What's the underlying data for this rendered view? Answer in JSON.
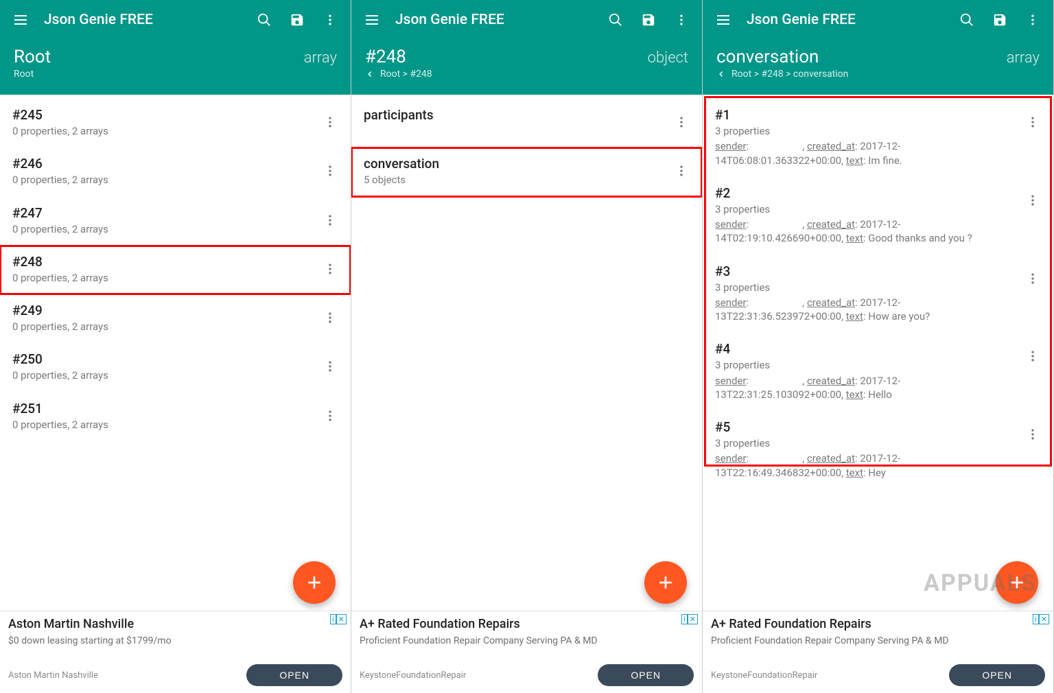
{
  "app_title": "Json Genie FREE",
  "screens": [
    {
      "header": {
        "name": "Root",
        "type": "array",
        "breadcrumb": "Root",
        "has_back": false
      },
      "items": [
        {
          "title": "#245",
          "sub": "0 properties, 2 arrays"
        },
        {
          "title": "#246",
          "sub": "0 properties, 2 arrays"
        },
        {
          "title": "#247",
          "sub": "0 properties, 2 arrays"
        },
        {
          "title": "#248",
          "sub": "0 properties, 2 arrays",
          "highlighted": true
        },
        {
          "title": "#249",
          "sub": "0 properties, 2 arrays"
        },
        {
          "title": "#250",
          "sub": "0 properties, 2 arrays"
        },
        {
          "title": "#251",
          "sub": "0 properties, 2 arrays"
        }
      ],
      "ad": {
        "title": "Aston Martin Nashville",
        "sub": "$0 down leasing starting at $1799/mo",
        "brand": "Aston Martin Nashville",
        "cta": "OPEN"
      }
    },
    {
      "header": {
        "name": "#248",
        "type": "object",
        "breadcrumb": "Root > #248",
        "has_back": true
      },
      "items": [
        {
          "title": "participants",
          "sub_redacted": true
        },
        {
          "title": "conversation",
          "sub": "5 objects",
          "highlighted": true
        }
      ],
      "ad": {
        "title": "A+ Rated Foundation Repairs",
        "sub": "Proficient Foundation Repair Company Serving PA & MD",
        "brand": "KeystoneFoundationRepair",
        "cta": "OPEN"
      }
    },
    {
      "header": {
        "name": "conversation",
        "type": "array",
        "breadcrumb": "Root > #248 > conversation",
        "has_back": true
      },
      "big_highlight": true,
      "items": [
        {
          "title": "#1",
          "sub": "3 properties",
          "detail_html": "<span class='key'>sender</span>: <span class='redact'>xxxxxxxxxx</span>, <span class='key'>created_at</span>: 2017-12-14T06:08:01.363322+00:00, <span class='key'>text</span>: Im fine."
        },
        {
          "title": "#2",
          "sub": "3 properties",
          "detail_html": "<span class='key'>sender</span>: <span class='redact'>xxxxxxxxxx</span>, <span class='key'>created_at</span>: 2017-12-14T02:19:10.426690+00:00, <span class='key'>text</span>: Good thanks and you ?"
        },
        {
          "title": "#3",
          "sub": "3 properties",
          "detail_html": "<span class='key'>sender</span>: <span class='redact'>xxxxxxxxxx</span>, <span class='key'>created_at</span>: 2017-12-13T22:31:36.523972+00:00, <span class='key'>text</span>: How are you?"
        },
        {
          "title": "#4",
          "sub": "3 properties",
          "detail_html": "<span class='key'>sender</span>: <span class='redact'>xxxxxxxxxx</span>, <span class='key'>created_at</span>: 2017-12-13T22:31:25.103092+00:00, <span class='key'>text</span>: Hello"
        },
        {
          "title": "#5",
          "sub": "3 properties",
          "detail_html": "<span class='key'>sender</span>: <span class='redact'>xxxxxxxxxx</span>, <span class='key'>created_at</span>: 2017-12-13T22:16:49.346832+00:00, <span class='key'>text</span>: Hey"
        }
      ],
      "ad": {
        "title": "A+ Rated Foundation Repairs",
        "sub": "Proficient Foundation Repair Company Serving PA & MD",
        "brand": "KeystoneFoundationRepair",
        "cta": "OPEN"
      },
      "watermark": "APPUALS"
    }
  ],
  "ad_badge": {
    "info": "i",
    "close": "✕"
  }
}
